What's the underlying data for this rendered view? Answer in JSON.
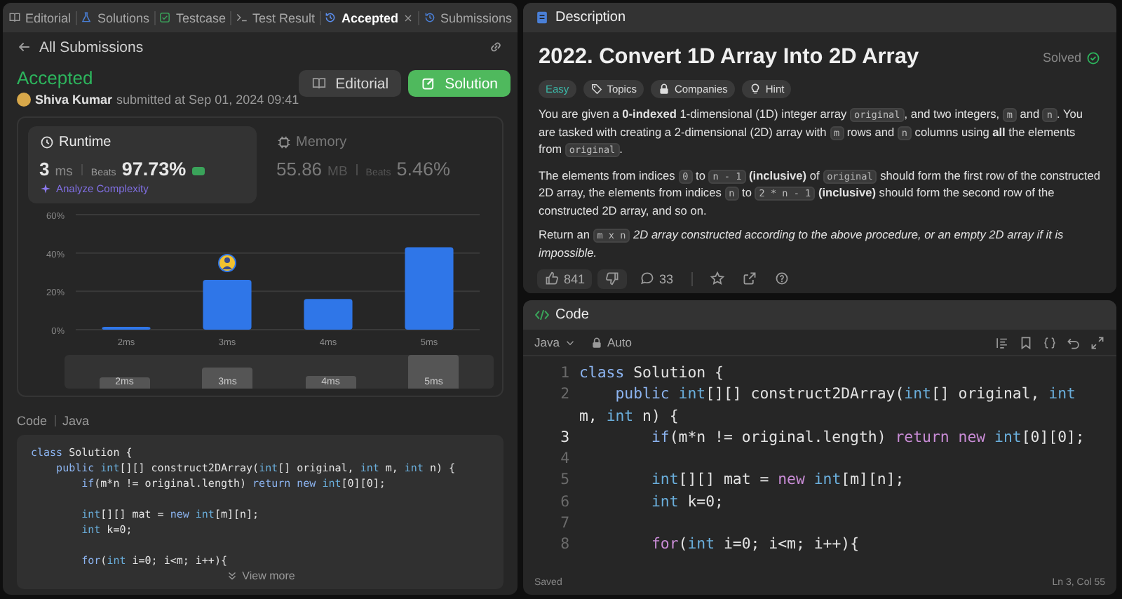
{
  "left_panel": {
    "tabs": [
      {
        "label": "Editorial",
        "selected": false,
        "closable": false
      },
      {
        "label": "Solutions",
        "selected": false,
        "closable": false
      },
      {
        "label": "Testcase",
        "selected": false,
        "closable": false
      },
      {
        "label": "Test Result",
        "selected": false,
        "closable": false
      },
      {
        "label": "Accepted",
        "selected": true,
        "closable": true
      },
      {
        "label": "Submissions",
        "selected": false,
        "closable": false
      }
    ],
    "back_link": "All Submissions",
    "status": "Accepted",
    "author": "Shiva Kumar",
    "submitted": "submitted at Sep 01, 2024 09:41",
    "buttons": [
      {
        "label": "Editorial",
        "kind": "secondary"
      },
      {
        "label": "Solution",
        "kind": "primary"
      }
    ],
    "stats": [
      {
        "label": "Runtime",
        "value": "3",
        "unit": "ms",
        "beats_label": "Beats",
        "beats": "97.73%",
        "selected": true,
        "badge": true
      },
      {
        "label": "Memory",
        "value": "55.86",
        "unit": "MB",
        "beats_label": "Beats",
        "beats": "5.46%",
        "selected": false,
        "badge": false
      }
    ],
    "analyze_link": "Analyze Complexity",
    "chart": {
      "chart_data": {
        "type": "bar",
        "categories": [
          "2ms",
          "3ms",
          "4ms",
          "5ms"
        ],
        "values": [
          1.5,
          26,
          16,
          43
        ],
        "ylim": [
          0,
          60
        ],
        "yticks": [
          {
            "value": 0,
            "label": "0%"
          },
          {
            "value": 20,
            "label": "20%"
          },
          {
            "value": 40,
            "label": "40%"
          },
          {
            "value": 60,
            "label": "60%"
          }
        ]
      }
    },
    "overview_labels": [
      "2ms",
      "3ms",
      "4ms",
      "5ms"
    ],
    "code_label": "Code",
    "code_language": "Java",
    "code_lines": [
      {
        "tokens": [
          {
            "text": "class ",
            "kind": "keyword"
          },
          {
            "text": "Solution {",
            "kind": "plain"
          }
        ]
      },
      {
        "tokens": [
          {
            "text": "    public ",
            "kind": "keyword"
          },
          {
            "text": "int",
            "kind": "type"
          },
          {
            "text": "[][] construct2DArray(",
            "kind": "plain"
          },
          {
            "text": "int",
            "kind": "type"
          },
          {
            "text": "[] original, ",
            "kind": "plain"
          },
          {
            "text": "int",
            "kind": "type"
          },
          {
            "text": " m, ",
            "kind": "plain"
          },
          {
            "text": "int",
            "kind": "type"
          },
          {
            "text": " n) {",
            "kind": "plain"
          }
        ]
      },
      {
        "tokens": [
          {
            "text": "        if",
            "kind": "keyword"
          },
          {
            "text": "(m*n != original.length) ",
            "kind": "plain"
          },
          {
            "text": "return new ",
            "kind": "keyword"
          },
          {
            "text": "int",
            "kind": "type"
          },
          {
            "text": "[0][0];",
            "kind": "plain"
          }
        ]
      },
      {
        "blank": true
      },
      {
        "tokens": [
          {
            "text": "        int",
            "kind": "type"
          },
          {
            "text": "[][] mat = ",
            "kind": "plain"
          },
          {
            "text": "new ",
            "kind": "keyword"
          },
          {
            "text": "int",
            "kind": "type"
          },
          {
            "text": "[m][n];",
            "kind": "plain"
          }
        ]
      },
      {
        "tokens": [
          {
            "text": "        int",
            "kind": "type"
          },
          {
            "text": " k=0;",
            "kind": "plain"
          }
        ]
      },
      {
        "blank": true
      },
      {
        "tokens": [
          {
            "text": "        for",
            "kind": "keyword"
          },
          {
            "text": "(",
            "kind": "plain"
          },
          {
            "text": "int",
            "kind": "type"
          },
          {
            "text": " i=0; i<m; i++){",
            "kind": "plain"
          }
        ]
      }
    ],
    "view_more": "View more"
  },
  "description_panel": {
    "tab": "Description",
    "title": "2022. Convert 1D Array Into 2D Array",
    "solved": "Solved",
    "tags": [
      {
        "label": "Easy",
        "kind": "difficulty"
      },
      {
        "label": "Topics",
        "kind": "topics"
      },
      {
        "label": "Companies",
        "kind": "companies"
      },
      {
        "label": "Hint",
        "kind": "hint"
      }
    ],
    "paragraphs": [
      [
        {
          "text": "You are given a **0-indexed** 1-dimensional (1D) integer array ",
          "kind": "text"
        },
        {
          "text": "original",
          "kind": "code"
        },
        {
          "text": ", and two integers, ",
          "kind": "text"
        },
        {
          "text": "m",
          "kind": "code"
        },
        {
          "text": " and ",
          "kind": "text"
        },
        {
          "text": "n",
          "kind": "code"
        },
        {
          "text": ". You are tasked with creating a 2-dimensional (2D) array with ",
          "kind": "text"
        },
        {
          "text": "m",
          "kind": "code"
        },
        {
          "text": " rows and ",
          "kind": "text"
        },
        {
          "text": "n",
          "kind": "code"
        },
        {
          "text": " columns using **all** the elements from ",
          "kind": "text"
        },
        {
          "text": "original",
          "kind": "code"
        },
        {
          "text": ".",
          "kind": "text"
        }
      ],
      [
        {
          "text": "The elements from indices ",
          "kind": "text"
        },
        {
          "text": "0",
          "kind": "code"
        },
        {
          "text": " to ",
          "kind": "text"
        },
        {
          "text": "n - 1",
          "kind": "code"
        },
        {
          "text": " **(inclusive)** of ",
          "kind": "text"
        },
        {
          "text": "original",
          "kind": "code"
        },
        {
          "text": " should form the first row of the constructed 2D array, the elements from indices ",
          "kind": "text"
        },
        {
          "text": "n",
          "kind": "code"
        },
        {
          "text": " to ",
          "kind": "text"
        },
        {
          "text": "2 * n - 1",
          "kind": "code"
        },
        {
          "text": " **(inclusive)** should form the second row of the constructed 2D array, and so on.",
          "kind": "text"
        }
      ],
      [
        {
          "text": "Return an ",
          "kind": "text"
        },
        {
          "text": "m x n",
          "kind": "code"
        },
        {
          "text": " *2D array constructed according to the above procedure, or an empty 2D array if it is impossible.*",
          "kind": "text"
        }
      ]
    ],
    "likes": "841",
    "comments": "33"
  },
  "editor_panel": {
    "tab": "Code",
    "language": "Java",
    "mode": "Auto",
    "lines": [
      {
        "number": "1",
        "current": false,
        "tokens": [
          {
            "text": "class ",
            "kind": "keyword"
          },
          {
            "text": "Solution {",
            "kind": "plain"
          }
        ]
      },
      {
        "number": "2",
        "current": false,
        "tokens": [
          {
            "text": "    public ",
            "kind": "keyword"
          },
          {
            "text": "int",
            "kind": "type"
          },
          {
            "text": "[][] construct2DArray(",
            "kind": "plain"
          },
          {
            "text": "int",
            "kind": "type"
          },
          {
            "text": "[] original, ",
            "kind": "plain"
          },
          {
            "text": "int",
            "kind": "type"
          },
          {
            "text": " m, ",
            "kind": "plain"
          },
          {
            "text": "int",
            "kind": "type"
          },
          {
            "text": " n) {",
            "kind": "plain"
          }
        ]
      },
      {
        "number": "3",
        "current": true,
        "tokens": [
          {
            "text": "        if",
            "kind": "keyword"
          },
          {
            "text": "(m*n != original.length) ",
            "kind": "plain"
          },
          {
            "text": "return new ",
            "kind": "control"
          },
          {
            "text": "int",
            "kind": "type"
          },
          {
            "text": "[0][0];",
            "kind": "plain"
          }
        ]
      },
      {
        "number": "4",
        "current": false,
        "blank": true
      },
      {
        "number": "5",
        "current": false,
        "tokens": [
          {
            "text": "        int",
            "kind": "type"
          },
          {
            "text": "[][] mat = ",
            "kind": "plain"
          },
          {
            "text": "new ",
            "kind": "control"
          },
          {
            "text": "int",
            "kind": "type"
          },
          {
            "text": "[m][n];",
            "kind": "plain"
          }
        ]
      },
      {
        "number": "6",
        "current": false,
        "tokens": [
          {
            "text": "        int",
            "kind": "type"
          },
          {
            "text": " k=0;",
            "kind": "plain"
          }
        ]
      },
      {
        "number": "7",
        "current": false,
        "blank": true
      },
      {
        "number": "8",
        "current": false,
        "tokens": [
          {
            "text": "        for",
            "kind": "control"
          },
          {
            "text": "(",
            "kind": "plain"
          },
          {
            "text": "int",
            "kind": "type"
          },
          {
            "text": " i=0; i<m; i++){",
            "kind": "plain"
          }
        ]
      }
    ],
    "status": "Saved",
    "position": "Ln 3, Col 55"
  }
}
